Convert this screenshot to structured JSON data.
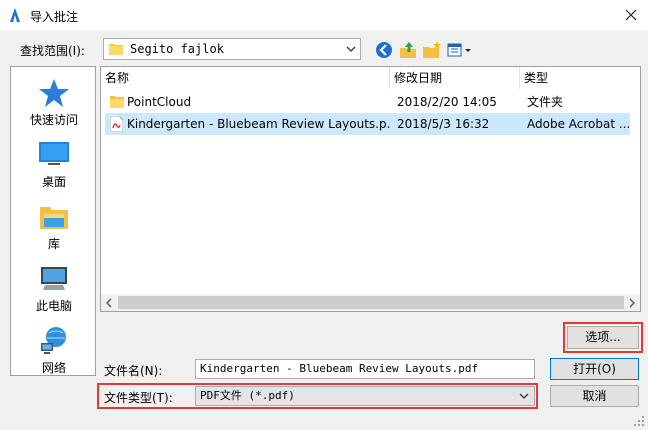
{
  "window": {
    "title": "导入批注"
  },
  "lookin": {
    "label": "查找范围(I):",
    "value": "Segito fajlok"
  },
  "toolbar": {
    "icons": [
      "back-icon",
      "up-folder-icon",
      "new-folder-icon",
      "view-menu-icon"
    ]
  },
  "places": [
    {
      "label": "快速访问",
      "icon": "star-icon"
    },
    {
      "label": "桌面",
      "icon": "desktop-icon"
    },
    {
      "label": "库",
      "icon": "library-icon"
    },
    {
      "label": "此电脑",
      "icon": "computer-icon"
    },
    {
      "label": "网络",
      "icon": "network-icon"
    }
  ],
  "columns": [
    "名称",
    "修改日期",
    "类型"
  ],
  "files": [
    {
      "name": "PointCloud",
      "date": "2018/2/20 14:05",
      "type": "文件夹",
      "icon": "folder-icon",
      "selected": false
    },
    {
      "name": "Kindergarten - Bluebeam Review Layouts.p...",
      "date": "2018/5/3 16:32",
      "type": "Adobe Acrobat ...",
      "icon": "pdf-icon",
      "selected": true
    }
  ],
  "buttons": {
    "options": "选项...",
    "open": "打开(O)",
    "cancel": "取消"
  },
  "filename": {
    "label": "文件名(N):",
    "value": "Kindergarten - Bluebeam Review Layouts.pdf"
  },
  "filetype": {
    "label": "文件类型(T):",
    "value": "PDF文件 (*.pdf)"
  },
  "colors": {
    "selection": "#cce8ff",
    "highlight": "#e53935",
    "accent": "#0078d7"
  }
}
